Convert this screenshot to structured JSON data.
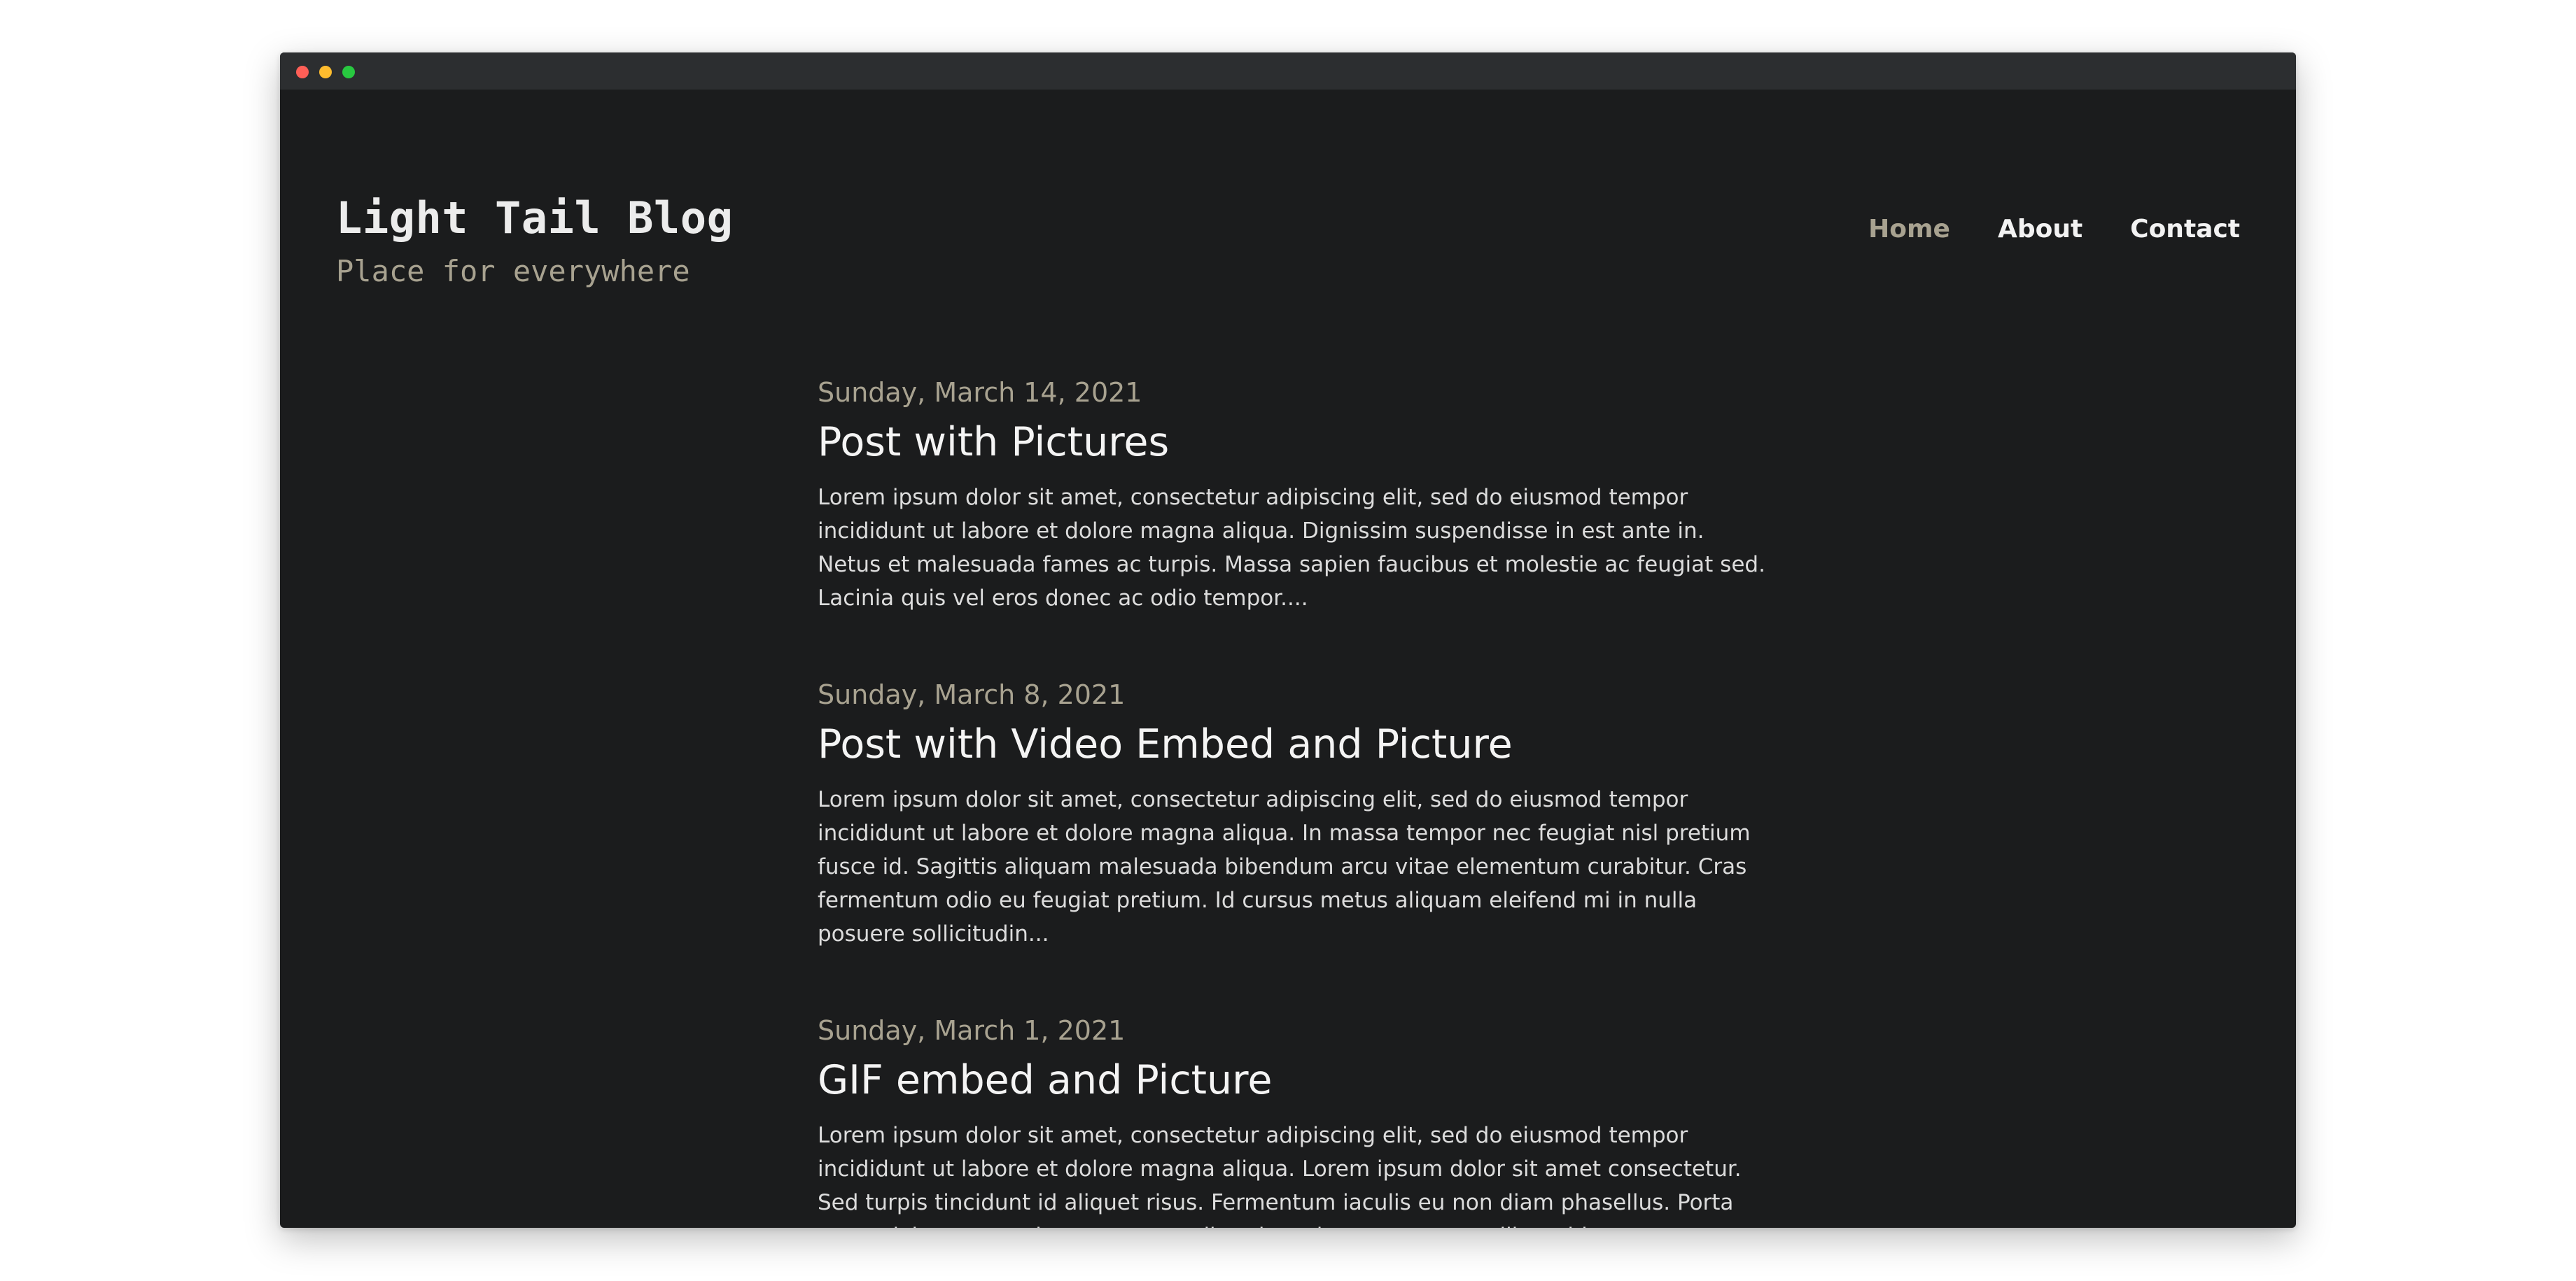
{
  "window": {
    "controls": [
      "close",
      "minimize",
      "maximize"
    ],
    "colors": {
      "background": "#1b1c1d",
      "titlebar": "#2c2e30",
      "accent": "#a8a290"
    }
  },
  "site": {
    "title": "Light Tail Blog",
    "tagline": "Place for everywhere"
  },
  "nav": {
    "items": [
      {
        "label": "Home",
        "active": true
      },
      {
        "label": "About",
        "active": false
      },
      {
        "label": "Contact",
        "active": false
      }
    ]
  },
  "posts": [
    {
      "date": "Sunday, March 14, 2021",
      "title": "Post with Pictures",
      "excerpt": "Lorem ipsum dolor sit amet, consectetur adipiscing elit, sed do eiusmod tempor incididunt ut labore et dolore magna aliqua. Dignissim suspendisse in est ante in. Netus et malesuada fames ac turpis. Massa sapien faucibus et molestie ac feugiat sed. Lacinia quis vel eros donec ac odio tempor...."
    },
    {
      "date": "Sunday, March 8, 2021",
      "title": "Post with Video Embed and Picture",
      "excerpt": "Lorem ipsum dolor sit amet, consectetur adipiscing elit, sed do eiusmod tempor incididunt ut labore et dolore magna aliqua. In massa tempor nec feugiat nisl pretium fusce id. Sagittis aliquam malesuada bibendum arcu vitae elementum curabitur. Cras fermentum odio eu feugiat pretium. Id cursus metus aliquam eleifend mi in nulla posuere sollicitudin..."
    },
    {
      "date": "Sunday, March 1, 2021",
      "title": "GIF embed and Picture",
      "excerpt": "Lorem ipsum dolor sit amet, consectetur adipiscing elit, sed do eiusmod tempor incididunt ut labore et dolore magna aliqua. Lorem ipsum dolor sit amet consectetur. Sed turpis tincidunt id aliquet risus. Fermentum iaculis eu non diam phasellus. Porta non pulvinar neque laoreet suspendisse interdum consectetur libero id..."
    }
  ]
}
